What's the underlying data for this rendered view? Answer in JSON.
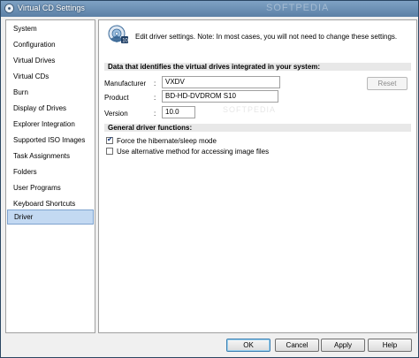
{
  "window": {
    "title": "Virtual CD Settings",
    "watermark_title": "SOFTPEDIA"
  },
  "sidebar": {
    "items": [
      {
        "label": "System"
      },
      {
        "label": "Configuration"
      },
      {
        "label": "Virtual Drives"
      },
      {
        "label": "Virtual CDs"
      },
      {
        "label": "Burn"
      },
      {
        "label": "Display of Drives"
      },
      {
        "label": "Explorer Integration"
      },
      {
        "label": "Supported ISO Images"
      },
      {
        "label": "Task Assignments"
      },
      {
        "label": "Folders"
      },
      {
        "label": "User Programs"
      },
      {
        "label": "Keyboard Shortcuts"
      },
      {
        "label": "Driver"
      }
    ],
    "selected": "Driver"
  },
  "panel": {
    "header_text": "Edit driver settings. Note: In most cases, you will not need to change these settings.",
    "section_identifies": "Data that identifies the virtual drives integrated in your system:",
    "manufacturer_label": "Manufacturer",
    "manufacturer_value": "VXDV",
    "product_label": "Product",
    "product_value": "BD-HD-DVDROM S10",
    "version_label": "Version",
    "version_value": "10.0",
    "colon": ":",
    "reset_label": "Reset",
    "section_functions": "General driver functions:",
    "opt_hibernate": {
      "label": "Force the hibernate/sleep mode",
      "checked": true
    },
    "opt_alternative": {
      "label": "Use alternative method for accessing image files",
      "checked": false
    },
    "watermark": "SOFTPEDIA"
  },
  "buttons": {
    "ok": "OK",
    "cancel": "Cancel",
    "apply": "Apply",
    "help": "Help"
  },
  "colors": {
    "titlebar": "#6a8fb4",
    "selection": "#c3d9f2"
  }
}
